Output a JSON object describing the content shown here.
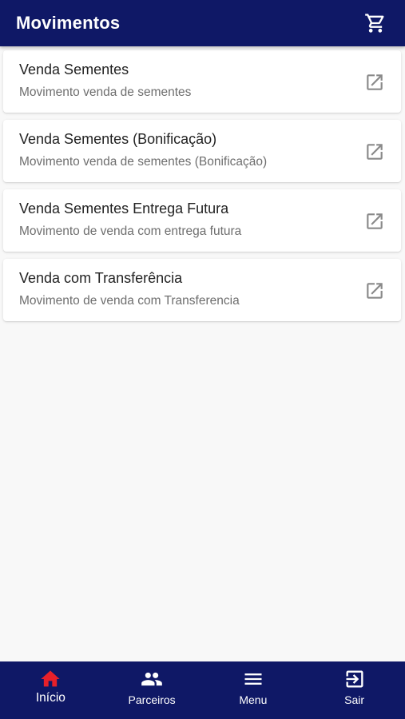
{
  "header": {
    "title": "Movimentos",
    "cart_icon": "shopping-cart-icon"
  },
  "movements": [
    {
      "title": "Venda Sementes",
      "subtitle": "Movimento venda de sementes",
      "icon": "open-in-new-icon"
    },
    {
      "title": "Venda Sementes (Bonificação)",
      "subtitle": "Movimento venda de sementes (Bonificação)",
      "icon": "open-in-new-icon"
    },
    {
      "title": "Venda Sementes Entrega Futura",
      "subtitle": "Movimento de venda com entrega futura",
      "icon": "open-in-new-icon"
    },
    {
      "title": "Venda com Transferência",
      "subtitle": "Movimento de venda com Transferencia",
      "icon": "open-in-new-icon"
    }
  ],
  "bottom_nav": {
    "items": [
      {
        "label": "Início",
        "icon": "home-icon",
        "active": true
      },
      {
        "label": "Parceiros",
        "icon": "people-icon",
        "active": false
      },
      {
        "label": "Menu",
        "icon": "menu-icon",
        "active": false
      },
      {
        "label": "Sair",
        "icon": "logout-icon",
        "active": false
      }
    ]
  },
  "colors": {
    "primary": "#0f1866",
    "active_nav": "#e8202a",
    "background": "#f8f8f8",
    "card": "#ffffff",
    "title_text": "#222222",
    "subtitle_text": "#6e6e6e",
    "icon_gray": "#8a8a8a"
  }
}
